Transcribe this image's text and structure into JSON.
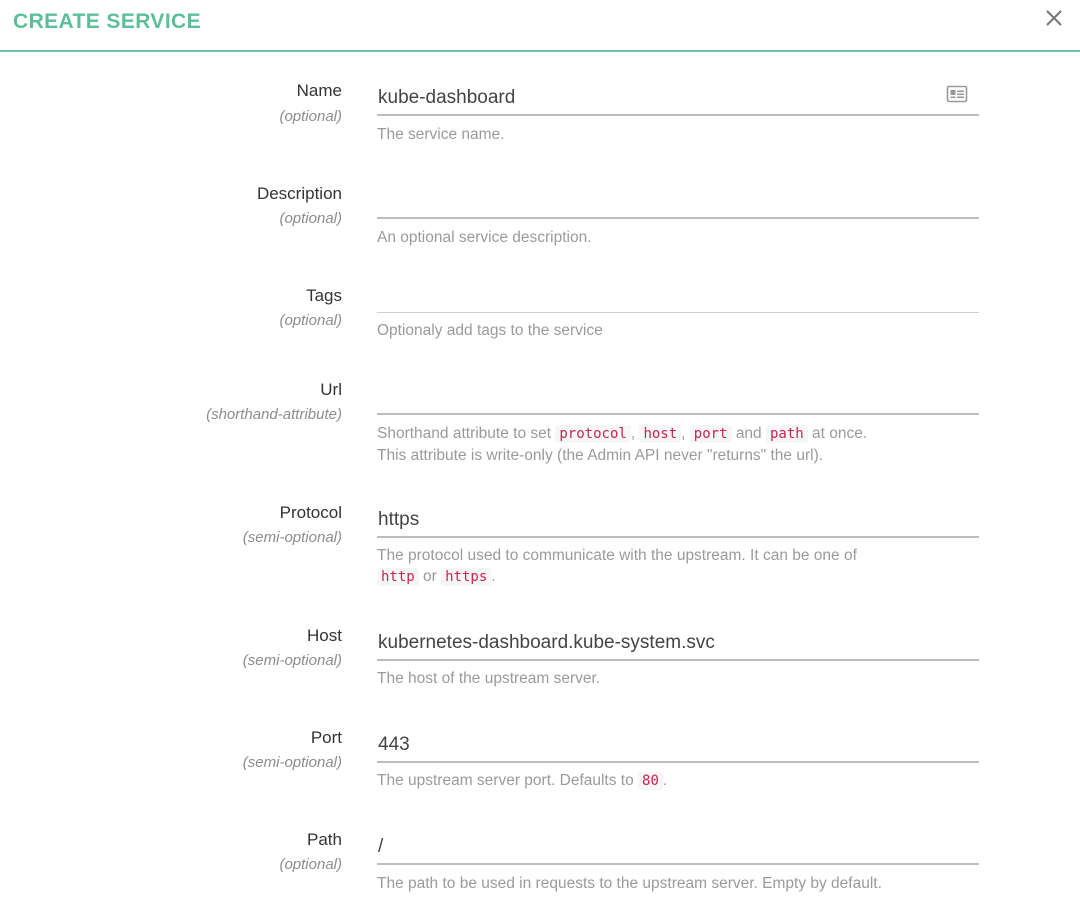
{
  "header": {
    "title": "CREATE SERVICE",
    "close_icon": "close-icon",
    "accent_color": "#5cbf98"
  },
  "fields": {
    "name": {
      "label": "Name",
      "qualifier": "(optional)",
      "value": "kube-dashboard",
      "help": "The service name.",
      "icon": "contact-card-icon"
    },
    "description": {
      "label": "Description",
      "qualifier": "(optional)",
      "value": "",
      "help": "An optional service description."
    },
    "tags": {
      "label": "Tags",
      "qualifier": "(optional)",
      "value": "",
      "help": "Optionaly add tags to the service"
    },
    "url": {
      "label": "Url",
      "qualifier": "(shorthand-attribute)",
      "value": "",
      "help_prefix": "Shorthand attribute to set",
      "help_codes": [
        "protocol",
        "host",
        "port",
        "path"
      ],
      "help_and": "and",
      "help_suffix": "at once.",
      "help_line2": "This attribute is write-only (the Admin API never \"returns\" the url)."
    },
    "protocol": {
      "label": "Protocol",
      "qualifier": "(semi-optional)",
      "value": "https",
      "help_prefix": "The protocol used to communicate with the upstream. It can be one of",
      "help_codes": [
        "http",
        "https"
      ],
      "help_or": "or"
    },
    "host": {
      "label": "Host",
      "qualifier": "(semi-optional)",
      "value": "kubernetes-dashboard.kube-system.svc",
      "help": "The host of the upstream server."
    },
    "port": {
      "label": "Port",
      "qualifier": "(semi-optional)",
      "value": "443",
      "help_prefix": "The upstream server port. Defaults to",
      "help_code": "80"
    },
    "path": {
      "label": "Path",
      "qualifier": "(optional)",
      "value": "/",
      "help": "The path to be used in requests to the upstream server. Empty by default."
    }
  }
}
